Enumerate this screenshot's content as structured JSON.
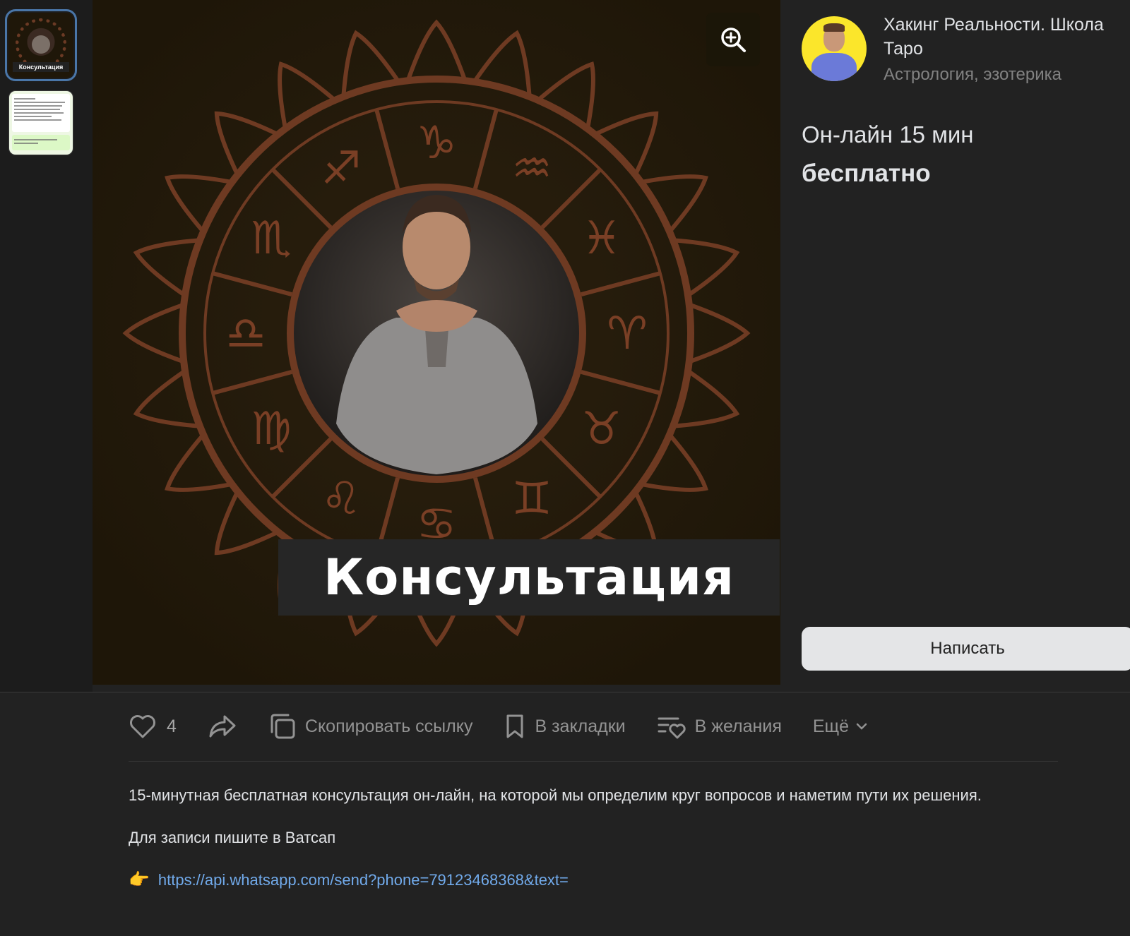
{
  "gallery": {
    "thumbnails": [
      {
        "caption": "Консультация",
        "active": true
      },
      {
        "caption": "",
        "active": false
      }
    ],
    "image_title": "Консультация"
  },
  "seller": {
    "name": "Хакинг Реальности. Школа Таро",
    "category": "Астрология, эзотерика"
  },
  "item": {
    "title": "Он-лайн 15 мин",
    "price": "бесплатно"
  },
  "buttons": {
    "write": "Написать"
  },
  "actions": {
    "likes_count": "4",
    "copy_link": "Скопировать ссылку",
    "bookmarks": "В закладки",
    "wishlist": "В желания",
    "more": "Ещё"
  },
  "description": {
    "paragraph1": "15-минутная бесплатная консультация он-лайн, на которой мы определим круг вопросов и наметим пути их решения.",
    "paragraph2": "Для записи пишите в Ватсап",
    "link": "https://api.whatsapp.com/send?phone=79123468368&text="
  },
  "colors": {
    "background": "#222222",
    "image_bg": "#241b0b",
    "ornament": "#6e3a22",
    "link": "#71aaeb",
    "button_bg": "#e4e5e7",
    "active_thumb": "#4a76a8"
  },
  "icons": {
    "zoom": "zoom-in-icon",
    "like": "heart-icon",
    "share": "share-icon",
    "copy": "copy-icon",
    "bookmark": "bookmark-icon",
    "wishlist": "wishlist-icon",
    "more": "chevron-down-icon",
    "pointer": "pointing-hand-icon"
  }
}
